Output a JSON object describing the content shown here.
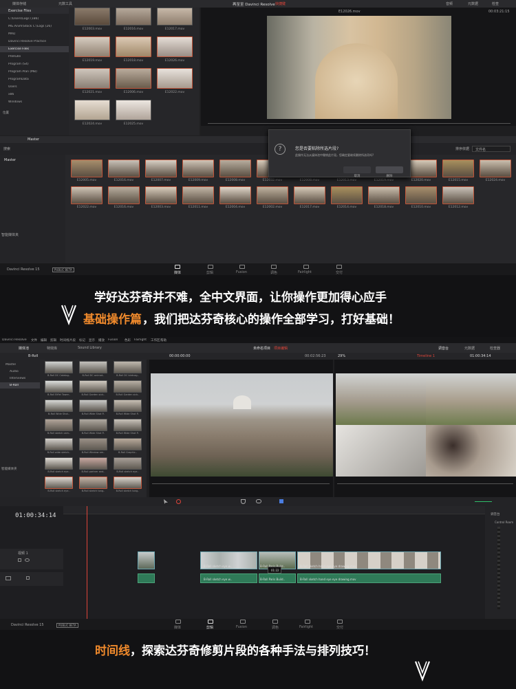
{
  "s1": {
    "tab_media": "媒体存储",
    "tab_sync": "元数工具",
    "title": "再至至 Davinci Resolve",
    "title_tag": "快捷键",
    "clip_name": "E12026.mov",
    "timecode": "00:03:21:15",
    "right_tabs": [
      "音频",
      "元数据",
      "检查"
    ],
    "bin_header": "Exercise Files",
    "folders": [
      "C:\\Users\\Logs (186)",
      "MG.Anim\\Stock C:\\Logs (26)",
      "MAD",
      "Davinci Resolve Practice",
      "Exercise Files",
      "PreRulle",
      "Program (S4)",
      "Program Plan (MB)",
      "ProgramData",
      "Users",
      "x86",
      "Windows"
    ],
    "folder_bottom": "位置",
    "top_clips": [
      "E12003.mov",
      "E12016.mov",
      "E12017.mov",
      "E12019.mov",
      "E12018.mov",
      "E12026.mov",
      "E12021.mov",
      "E12006.mov",
      "E12022.mov",
      "E12024.mov",
      "E12025.mov"
    ],
    "master_tab": "Master",
    "master_side": "Master",
    "search_label": "搜索",
    "pool_clips_row1": [
      "E12005.mov",
      "E12016.mov",
      "E12007.mov",
      "E12009.mov",
      "E12008.mov",
      "E12032.mov",
      "E12008.mov",
      "E12013.mov",
      "E12019.mov",
      "E12020.mov",
      "E12015.mov",
      "E12024.mov"
    ],
    "pool_clips_row2": [
      "E12022.mov",
      "E12016.mov",
      "E12003.mov",
      "E12011.mov",
      "E12004.mov",
      "E12002.mov",
      "E12017.mov",
      "E12014.mov",
      "E12018.mov",
      "E12010.mov",
      "E12012.mov"
    ],
    "smart_bins": "智能媒体夹",
    "dialog": {
      "title": "您是否要粘除所选片段?",
      "body": "此操作无法从媒体池中撤销此片段，您确定要继续删除所选项吗?",
      "cancel": "取消",
      "confirm": "删除"
    },
    "sort_label": "排序依据",
    "sort_value": "文件名",
    "app_name": "Davinci Resolve 15",
    "beta": "PUBLIC BETA",
    "nav": [
      "媒体",
      "剪辑",
      "Fusion",
      "调色",
      "Fairlight",
      "交付"
    ]
  },
  "banner1": {
    "line1": "学好达芬奇并不难，全中文界面，让你操作更加得心应手",
    "line2_highlight": "基础操作篇",
    "line2_rest": "，我们把达芬奇核心的操作全部学习，打好基础！"
  },
  "s2": {
    "menu": [
      "Davinci Resolve",
      "文件",
      "编辑",
      "剪辑",
      "时间线",
      "片段",
      "标记",
      "显示",
      "播放",
      "Fusion",
      "色彩",
      "Fairlight",
      "工作区",
      "帮助"
    ],
    "tabs": [
      "媒体池",
      "特效库",
      "Sound Library"
    ],
    "project": "未命名项目",
    "project_tag": "项目编辑",
    "right_btns": [
      "调音台",
      "元数据",
      "检查器"
    ],
    "bin_tab": "B-Roll",
    "tc_left": "00:00:00:00",
    "zoom": "29%",
    "tc_mid": "00:02:56:23",
    "timeline_name": "Timeline 1",
    "tc_right": "01:00:34:14",
    "bins": [
      "Master",
      "Audio",
      "Interviews",
      "B-Roll"
    ],
    "smart": "智能媒体夹",
    "clip_labels": [
      "B-Roll DC Catalog..",
      "B-Roll DC animat..",
      "B-Roll DC birdcag..",
      "B-Roll Eiffel Tower..",
      "B-Roll Garden sick..",
      "B-Roll Garden sick..",
      "B-Roll Wide Shot..",
      "B-Roll Wide Shot P..",
      "B-Roll Wide Shot P..",
      "B-Roll sketch cam..",
      "B-Roll Wide Shot P..",
      "B-Roll Wide Shot P..",
      "B-Roll wide stetch..",
      "B-Roll Window am..",
      "B-Roll Graphic..",
      "B-Roll sketch eye..",
      "B-Roll partner and..",
      "B-Roll sketch eye..",
      "B-Roll sketch eye..",
      "B-Roll sketch tong..",
      "B-Roll sketch tong.."
    ],
    "big_timecode": "01:00:34:14",
    "track_v1": "视频 1",
    "tooltip": "01:22",
    "clips": [
      "B-Roll sketch eye w..",
      "B-Roll sketch eye wide",
      "B-Roll Paris Build..",
      "B-Roll sketch hand eye eye drawing.mov"
    ],
    "audio_clips": [
      "B-Roll sketch eye w..",
      "B-Roll sketch eye wide",
      "B-Roll Paris Build..",
      "B-Roll sketch hand eye eye drawing.mov"
    ],
    "mixer_title": "调音台",
    "control_room": "Control Room",
    "app_name": "Davinci Resolve 15",
    "beta": "PUBLIC BETA",
    "nav": [
      "媒体",
      "剪辑",
      "Fusion",
      "调色",
      "Fairlight",
      "交付"
    ]
  },
  "banner2": {
    "highlight": "时间线",
    "rest": "，探索达芬奇修剪片段的各种手法与排列技巧！"
  },
  "colors": {
    "accent": "#f08a2c",
    "clip_blue": "#3d6a72",
    "clip_green": "#2f7a58",
    "red_tag": "#e0453a"
  }
}
